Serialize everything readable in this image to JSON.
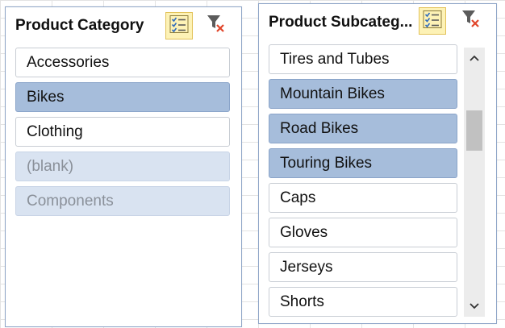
{
  "product_category": {
    "title": "Product Category",
    "items": [
      {
        "label": "Accessories",
        "state": "unselected"
      },
      {
        "label": "Bikes",
        "state": "selected"
      },
      {
        "label": "Clothing",
        "state": "unselected"
      },
      {
        "label": "(blank)",
        "state": "no-data"
      },
      {
        "label": "Components",
        "state": "no-data"
      }
    ]
  },
  "product_subcategory": {
    "title": "Product Subcateg...",
    "items": [
      {
        "label": "Tires and Tubes",
        "state": "unselected"
      },
      {
        "label": "Mountain Bikes",
        "state": "selected"
      },
      {
        "label": "Road Bikes",
        "state": "selected"
      },
      {
        "label": "Touring Bikes",
        "state": "selected"
      },
      {
        "label": "Caps",
        "state": "unselected"
      },
      {
        "label": "Gloves",
        "state": "unselected"
      },
      {
        "label": "Jerseys",
        "state": "unselected"
      },
      {
        "label": "Shorts",
        "state": "unselected"
      }
    ]
  },
  "icons": {
    "multi_select": "multi-select-icon",
    "clear_filter": "clear-filter-icon",
    "scroll_up": "chevron-up-icon",
    "scroll_down": "chevron-down-icon"
  },
  "colors": {
    "slicer_border": "#8fa6c8",
    "selected_item": "#a6bddb",
    "no_data_item": "#d9e3f1",
    "multi_select_active": "#fdf2b6",
    "clear_filter_x": "#e0452a"
  }
}
